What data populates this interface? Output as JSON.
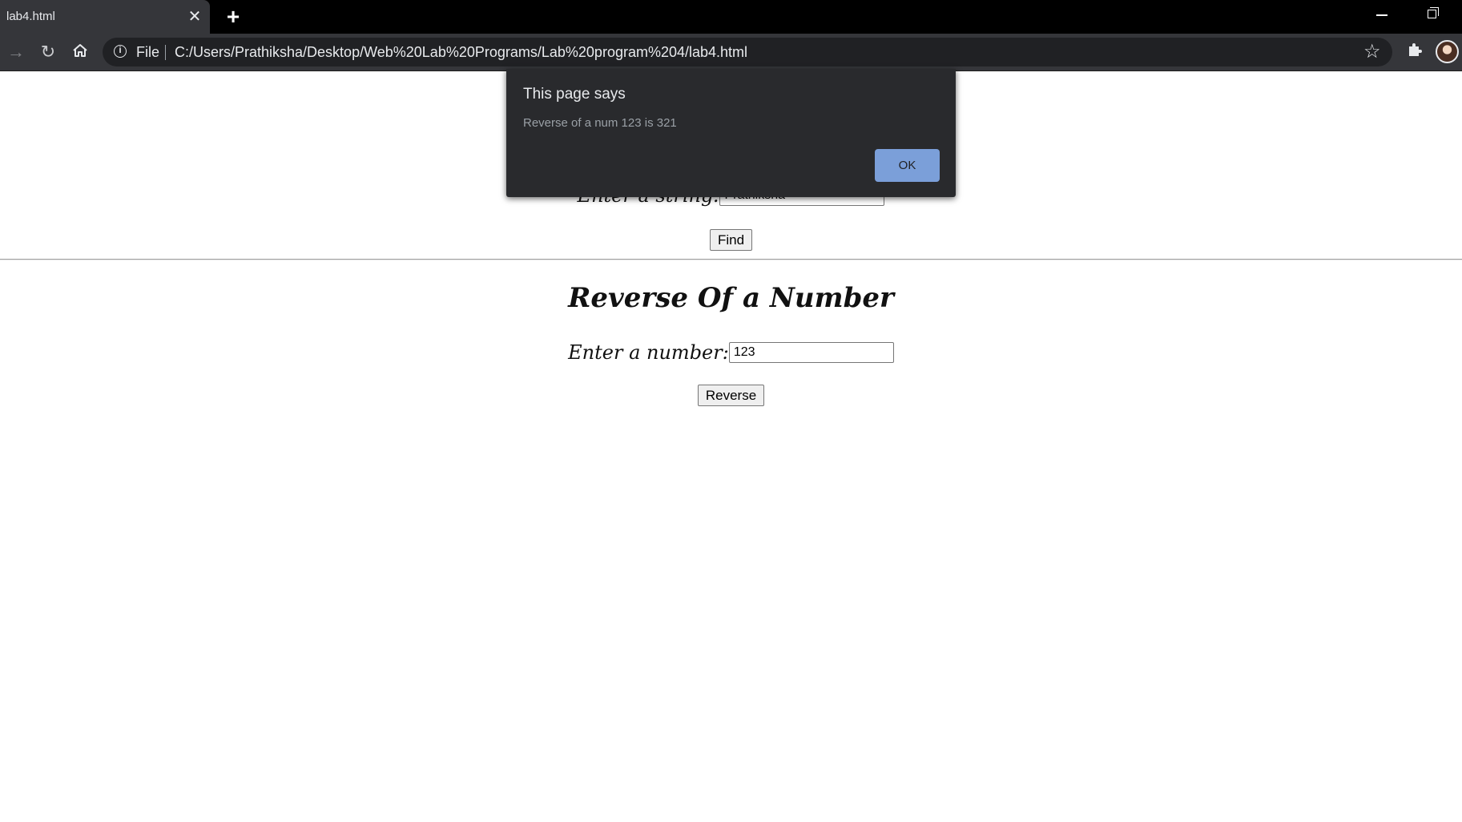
{
  "browser": {
    "tab_title": "lab4.html",
    "tab_close": "✕",
    "new_tab": "+",
    "address_scheme": "File",
    "url": "C:/Users/Prathiksha/Desktop/Web%20Lab%20Programs/Lab%20program%204/lab4.html"
  },
  "page": {
    "string_section": {
      "label": "Enter a string:",
      "input_value": "Prathiksha",
      "button_label": "Find"
    },
    "number_section": {
      "heading": "Reverse Of a Number",
      "label": "Enter a number:",
      "input_value": "123",
      "button_label": "Reverse"
    }
  },
  "dialog": {
    "title": "This page says",
    "message": "Reverse of a num 123 is 321",
    "ok_label": "OK"
  },
  "colors": {
    "chrome_bg": "#35363a",
    "dialog_bg": "#292a2d",
    "ok_button": "#8ab4f8"
  }
}
